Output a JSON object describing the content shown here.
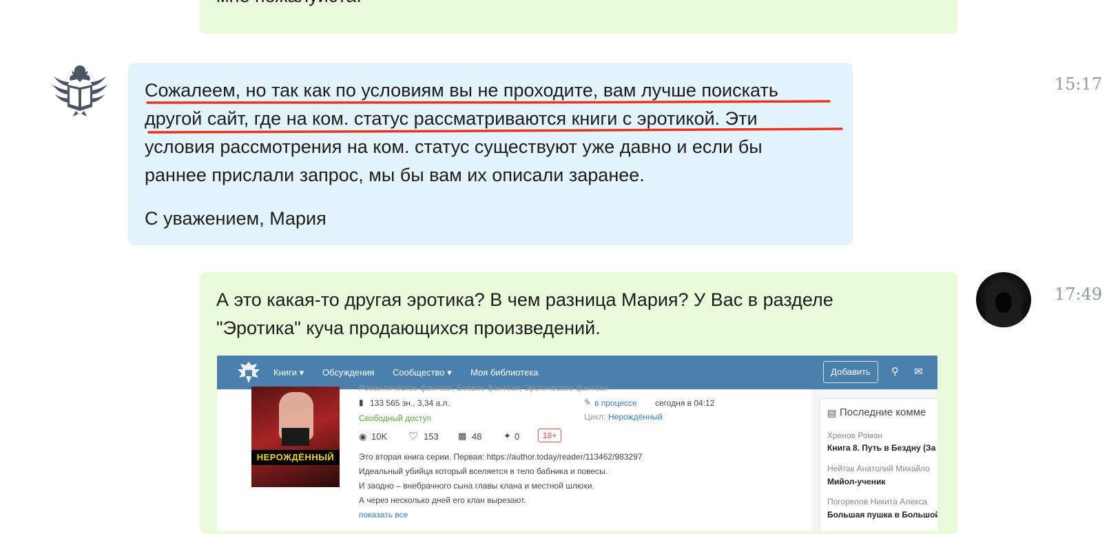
{
  "messages": [
    {
      "author": "user",
      "text": "мне пожалуйста."
    },
    {
      "author": "support",
      "paragraph1": [
        "Сожалеем, но так как по условиям вы не проходите, вам лучше поискать",
        "другой сайт, где на ком. статус рассматриваются книги с эротикой. Эти",
        "условия рассмотрения на ком. статус существуют уже давно и если бы",
        "раннее прислали запрос, мы бы вам их описали заранее."
      ],
      "signature": "С уважением, Мария",
      "time": "15:17"
    },
    {
      "author": "user",
      "lines": [
        "А это какая-то другая эротика? В чем разница Мария? У Вас в разделе",
        "\"Эротика\" куча продающихся произведений."
      ],
      "time": "17:49"
    }
  ],
  "attachment": {
    "nav": {
      "books": "Книги ▾",
      "discussions": "Обсуждения",
      "community": "Сообщество ▾",
      "library": "Моя библиотека",
      "add_button": "Добавить"
    },
    "cover_title": "НЕРОЖДЁННЫЙ",
    "genres": "Романтическое фэнтези, Боевое фэнтези, Эротическое фэнтези",
    "size": "133 565 зн., 3,34 а.л.",
    "access": "Свободный доступ",
    "status": "в процессе",
    "updated": "сегодня в 04:12",
    "cycle_label": "Цикл:",
    "cycle": "Нерождённый",
    "views": "10K",
    "likes": "153",
    "comments": "48",
    "rewards": "0",
    "age": "18+",
    "description": [
      "Это вторая книга серии. Первая: https://author.today/reader/113462/983297",
      "Идеальный убийца который вселяется в тело бабника и повесы.",
      "И заодно – внебрачного сына главы клана и местной шлюхи.",
      "А через несколько дней его клан вырезают."
    ],
    "show_all": "показать все",
    "sidebar": {
      "title": "Последние комме",
      "items": [
        {
          "name": "Хренов Роман",
          "book": "Книга 8. Путь в Бездну (За"
        },
        {
          "name": "Нейтак Анатолий Михайло",
          "book": "Мийол-ученик"
        },
        {
          "name": "Погорелов Никита Алекса",
          "book": "Большая пушка в Большой"
        }
      ]
    }
  },
  "colors": {
    "user_bubble": "#eafbdc",
    "support_bubble": "#e3f4fc",
    "underline": "#e8341c",
    "nav": "#4a7fae"
  }
}
